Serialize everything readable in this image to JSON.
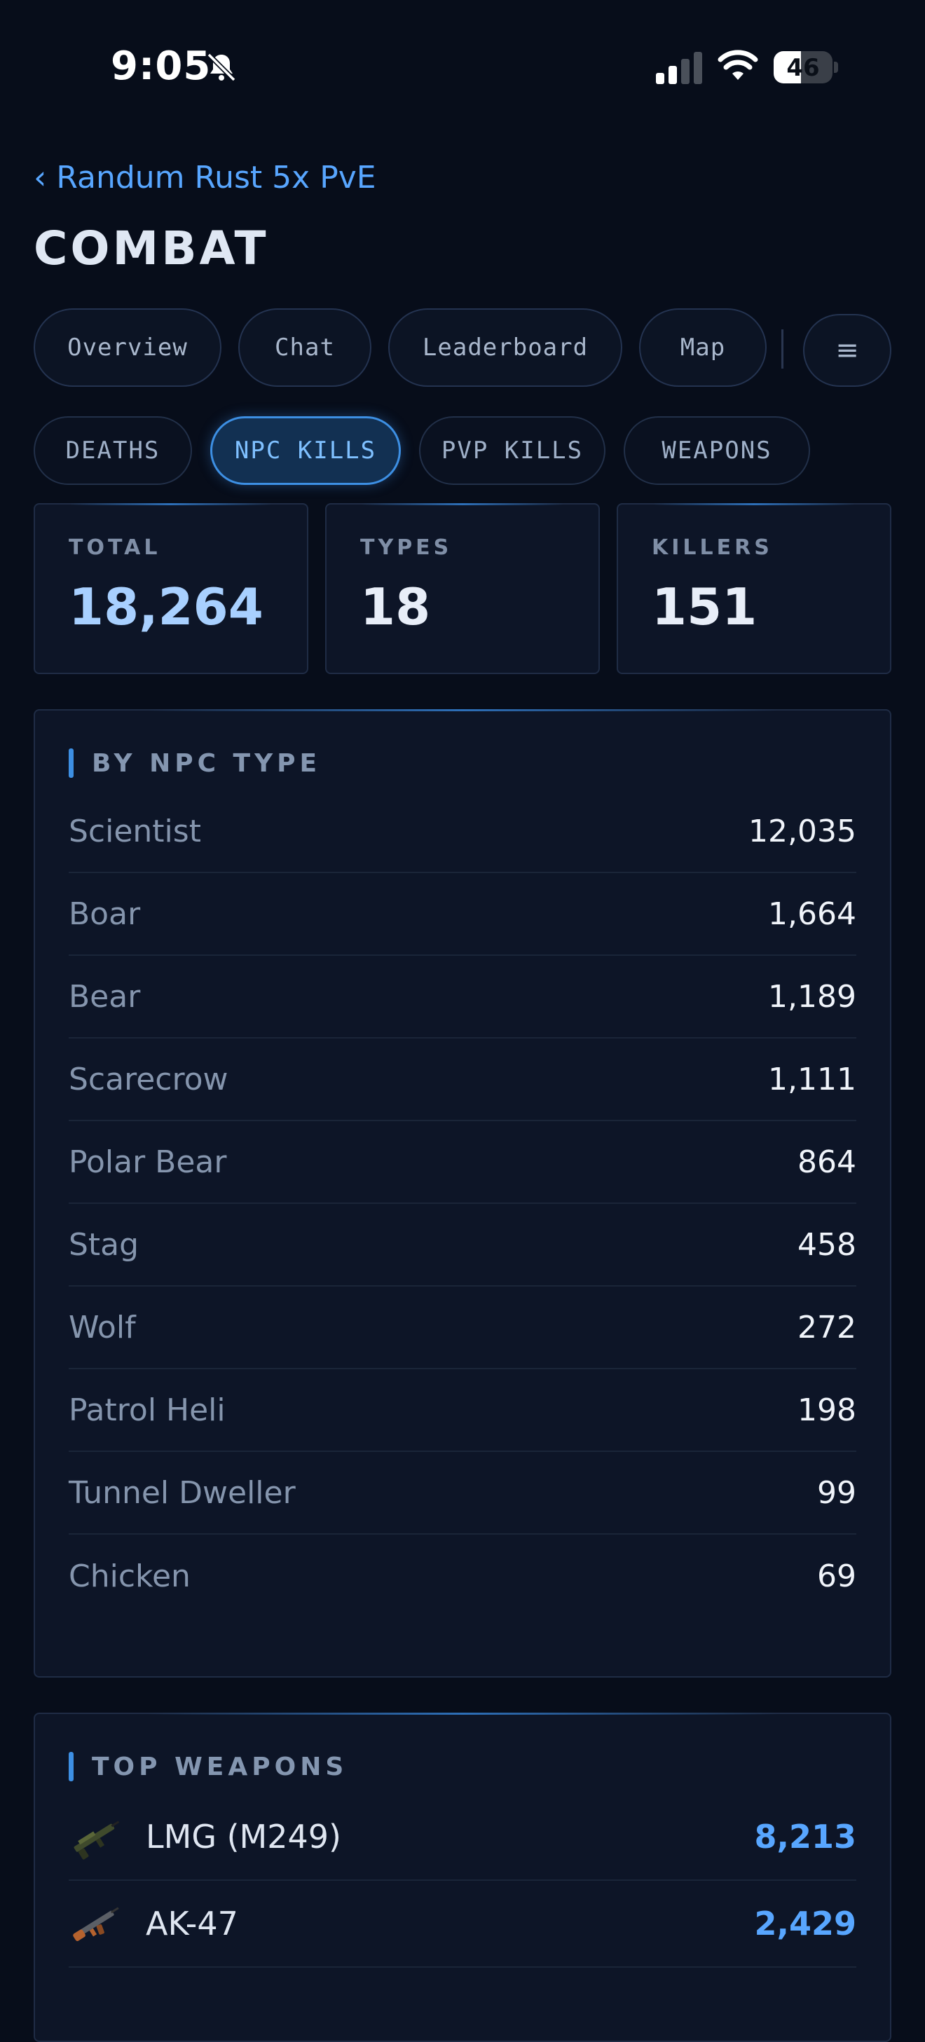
{
  "status_bar": {
    "time": "9:05",
    "battery": "46",
    "battery_level": 0.46
  },
  "header": {
    "back_label": "Randum Rust 5x PvE",
    "title": "COMBAT"
  },
  "nav_tabs": [
    "Overview",
    "Chat",
    "Leaderboard",
    "Map"
  ],
  "sub_tabs": [
    "DEATHS",
    "NPC KILLS",
    "PVP KILLS",
    "WEAPONS"
  ],
  "active_sub_tab": "NPC KILLS",
  "stats": [
    {
      "label": "TOTAL",
      "value": "18,264"
    },
    {
      "label": "TYPES",
      "value": "18"
    },
    {
      "label": "KILLERS",
      "value": "151"
    }
  ],
  "npc_section": {
    "title": "BY NPC TYPE",
    "rows": [
      {
        "name": "Scientist",
        "value": "12,035"
      },
      {
        "name": "Boar",
        "value": "1,664"
      },
      {
        "name": "Bear",
        "value": "1,189"
      },
      {
        "name": "Scarecrow",
        "value": "1,111"
      },
      {
        "name": "Polar Bear",
        "value": "864"
      },
      {
        "name": "Stag",
        "value": "458"
      },
      {
        "name": "Wolf",
        "value": "272"
      },
      {
        "name": "Patrol Heli",
        "value": "198"
      },
      {
        "name": "Tunnel Dweller",
        "value": "99"
      },
      {
        "name": "Chicken",
        "value": "69"
      }
    ]
  },
  "weapons_section": {
    "title": "TOP WEAPONS",
    "rows": [
      {
        "name": "LMG (M249)",
        "value": "8,213",
        "icon": "lmg-icon"
      },
      {
        "name": "AK-47",
        "value": "2,429",
        "icon": "ak47-icon"
      }
    ]
  },
  "colors": {
    "accent": "#58a6ff",
    "background": "#070d1a",
    "card": "#0d1527"
  }
}
